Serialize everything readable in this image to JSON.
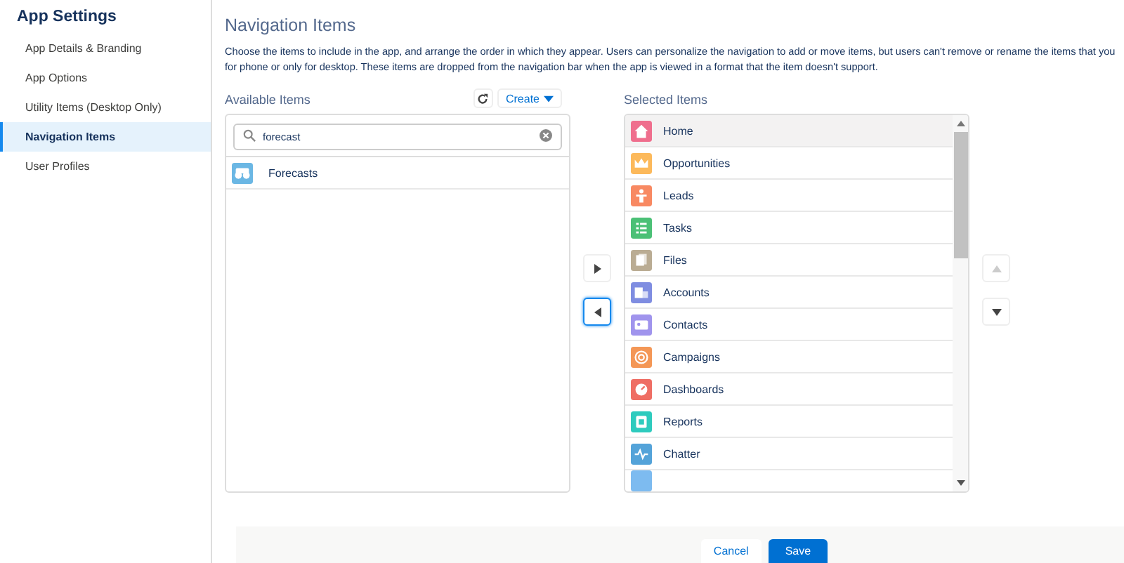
{
  "sidebar": {
    "title": "App Settings",
    "items": [
      {
        "label": "App Details & Branding",
        "selected": false
      },
      {
        "label": "App Options",
        "selected": false
      },
      {
        "label": "Utility Items (Desktop Only)",
        "selected": false
      },
      {
        "label": "Navigation Items",
        "selected": true
      },
      {
        "label": "User Profiles",
        "selected": false
      }
    ]
  },
  "page": {
    "title": "Navigation Items",
    "description": [
      "Choose the items to include in the app, and arrange the order in which they appear. Users can personalize the navigation to add or move items, but users can't remove or rename the items that you",
      "for phone or only for desktop. These items are dropped from the navigation bar when the app is viewed in a format that the item doesn't support."
    ]
  },
  "available": {
    "title": "Available Items",
    "create_label": "Create",
    "search": {
      "value": "forecast"
    },
    "items": [
      {
        "label": "Forecasts",
        "color": "#6bb7e4"
      }
    ]
  },
  "selected": {
    "title": "Selected Items",
    "items": [
      {
        "label": "Home",
        "kind": "home",
        "color": "#ef6e8d",
        "selected": true
      },
      {
        "label": "Opportunities",
        "kind": "crown",
        "color": "#fcb95b",
        "selected": false
      },
      {
        "label": "Leads",
        "kind": "person",
        "color": "#f88962",
        "selected": false
      },
      {
        "label": "Tasks",
        "kind": "list",
        "color": "#4bc076",
        "selected": false
      },
      {
        "label": "Files",
        "kind": "file",
        "color": "#baac93",
        "selected": false
      },
      {
        "label": "Accounts",
        "kind": "building",
        "color": "#7f8de1",
        "selected": false
      },
      {
        "label": "Contacts",
        "kind": "card",
        "color": "#a094ed",
        "selected": false
      },
      {
        "label": "Campaigns",
        "kind": "target",
        "color": "#f49756",
        "selected": false
      },
      {
        "label": "Dashboards",
        "kind": "gauge",
        "color": "#ef6e64",
        "selected": false
      },
      {
        "label": "Reports",
        "kind": "report",
        "color": "#2ecbbe",
        "selected": false
      },
      {
        "label": "Chatter",
        "kind": "pulse",
        "color": "#54a3d9",
        "selected": false
      }
    ]
  },
  "footer": {
    "cancel": "Cancel",
    "save": "Save"
  }
}
